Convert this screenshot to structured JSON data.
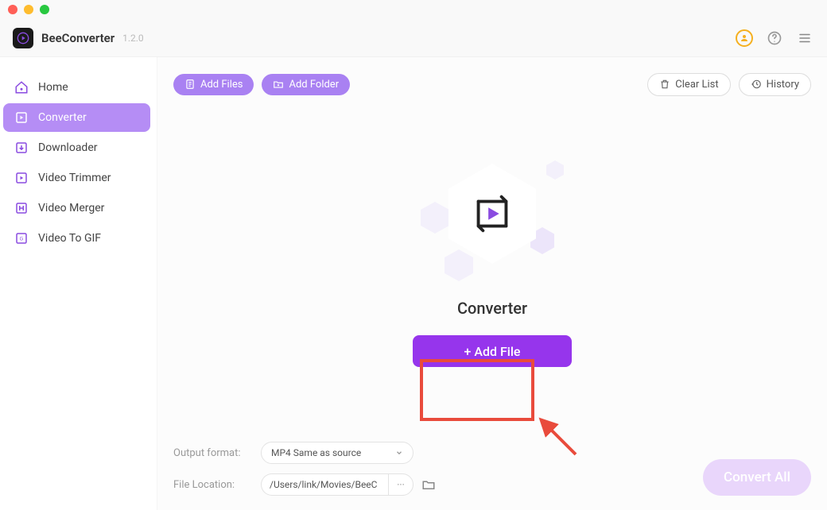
{
  "app": {
    "name": "BeeConverter",
    "version": "1.2.0"
  },
  "sidebar": {
    "items": [
      {
        "label": "Home"
      },
      {
        "label": "Converter"
      },
      {
        "label": "Downloader"
      },
      {
        "label": "Video Trimmer"
      },
      {
        "label": "Video Merger"
      },
      {
        "label": "Video To GIF"
      }
    ],
    "active_index": 1
  },
  "toolbar": {
    "add_files": "Add Files",
    "add_folder": "Add Folder",
    "clear_list": "Clear List",
    "history": "History"
  },
  "empty_state": {
    "title": "Converter",
    "add_file_button": "+ Add File"
  },
  "bottom": {
    "output_format_label": "Output format:",
    "output_format_value": "MP4 Same as source",
    "file_location_label": "File Location:",
    "file_location_value": "/Users/link/Movies/BeeC",
    "more_button": "···",
    "convert_all": "Convert All"
  }
}
